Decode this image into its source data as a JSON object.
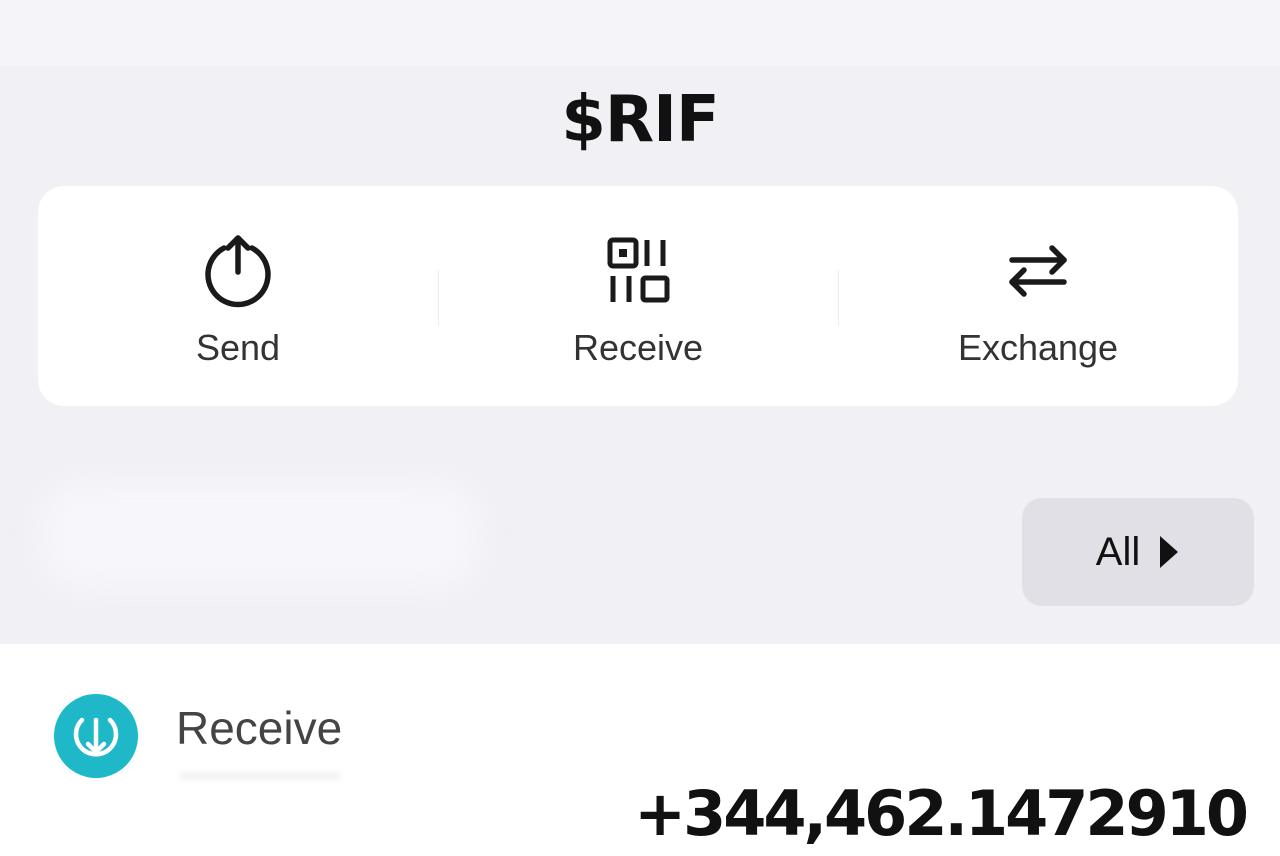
{
  "header": {
    "title": "$RIF"
  },
  "actions": [
    {
      "label": "Send",
      "icon": "send-icon"
    },
    {
      "label": "Receive",
      "icon": "qr-code-icon"
    },
    {
      "label": "Exchange",
      "icon": "exchange-icon"
    }
  ],
  "filter": {
    "label": "All",
    "icon": "caret-right-icon"
  },
  "transactions": [
    {
      "type": "Receive",
      "icon": "receive-icon",
      "amount": "+344,462.1472910",
      "icon_color": "#1fb8c8"
    }
  ],
  "colors": {
    "background": "#f1f0f5",
    "card": "#ffffff",
    "accent": "#1fb8c8",
    "filter_button": "#e1e0e6"
  }
}
